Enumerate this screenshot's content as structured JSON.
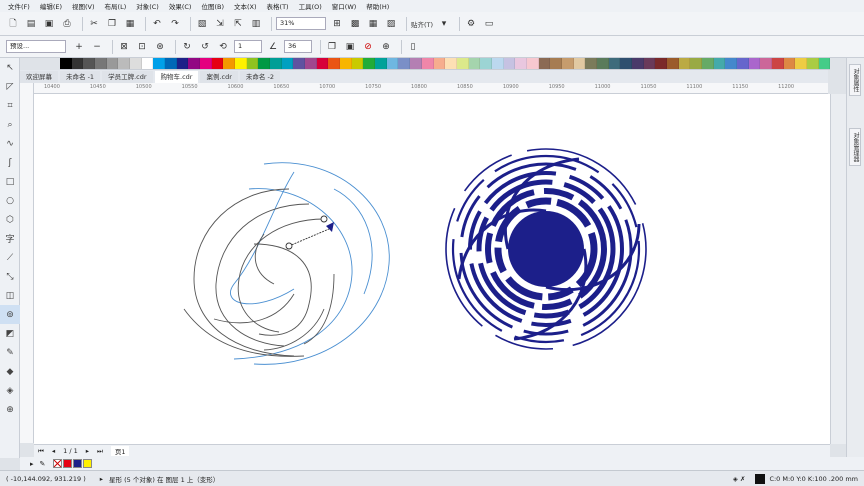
{
  "menu": [
    "文件(F)",
    "编辑(E)",
    "视图(V)",
    "布局(L)",
    "对象(C)",
    "效果(C)",
    "位图(B)",
    "文本(X)",
    "表格(T)",
    "工具(O)",
    "窗口(W)",
    "帮助(H)"
  ],
  "toolbar": {
    "zoom_value": "31%",
    "snap_label": "贴齐(T)"
  },
  "propertybar": {
    "preset_label": "预设...",
    "count_value": "1",
    "angle_value": "36"
  },
  "tabs": [
    {
      "label": "欢迎屏幕",
      "active": false
    },
    {
      "label": "未命名 -1",
      "active": false
    },
    {
      "label": "学员工牌.cdr",
      "active": false
    },
    {
      "label": "购物车.cdr",
      "active": true
    },
    {
      "label": "案例.cdr",
      "active": false
    },
    {
      "label": "未命名 -2",
      "active": false
    }
  ],
  "ruler_labels": [
    "10400",
    "10450",
    "10500",
    "10550",
    "10600",
    "10650",
    "10700",
    "10750",
    "10800",
    "10850",
    "10900",
    "10950",
    "11000",
    "11050",
    "11100",
    "11150",
    "11200"
  ],
  "docker": {
    "tab1": "对象属性",
    "tab2": "对象管理器"
  },
  "pagebar": {
    "page_count": "1 / 1",
    "page_name": "页1"
  },
  "status": {
    "coords": "( -10,144.092, 931.219 )",
    "object_info": "星形 (5 个对象) 在 图层 1 上（变形）",
    "fill_info": "C:0 M:0 Y:0 K:100 .200 mm"
  },
  "colors": {
    "spiral_fill": "#1c1f8a",
    "wire_blue": "#4a8fd1",
    "wire_gray": "#555555"
  },
  "palette": [
    "#000000",
    "#333333",
    "#555555",
    "#777777",
    "#999999",
    "#bbbbbb",
    "#dddddd",
    "#ffffff",
    "#00a0e9",
    "#0068b7",
    "#1d2088",
    "#920783",
    "#e4007f",
    "#e60012",
    "#f39800",
    "#fff100",
    "#8fc31f",
    "#009944",
    "#009e96",
    "#00a0c1",
    "#5f52a0",
    "#a0478f",
    "#d7003a",
    "#ea5514",
    "#f8b500",
    "#c9ca00",
    "#22ac38",
    "#00a29a",
    "#6fb7e1",
    "#7a8fc7",
    "#b47fb3",
    "#ef86a9",
    "#f6ad8e",
    "#fddfb4",
    "#dce98b",
    "#a5d4ad",
    "#9cd4d4",
    "#bcd8ef",
    "#c6c2e2",
    "#e9c7df",
    "#f7c8d0",
    "#8b6a54",
    "#a67c52",
    "#c69c6d",
    "#e1c9a2",
    "#7b7b5b",
    "#5a7b5b",
    "#3e6b7b",
    "#2f4f6f",
    "#4a3a6a",
    "#6a3a5a",
    "#7b2a2a",
    "#9b5b2b",
    "#bbaa44",
    "#99aa44",
    "#66aa66",
    "#44aaaa",
    "#4488cc",
    "#6666cc",
    "#aa66cc",
    "#cc6699",
    "#cc4444",
    "#dd8844",
    "#eecc44",
    "#aacc44",
    "#44cc88"
  ]
}
